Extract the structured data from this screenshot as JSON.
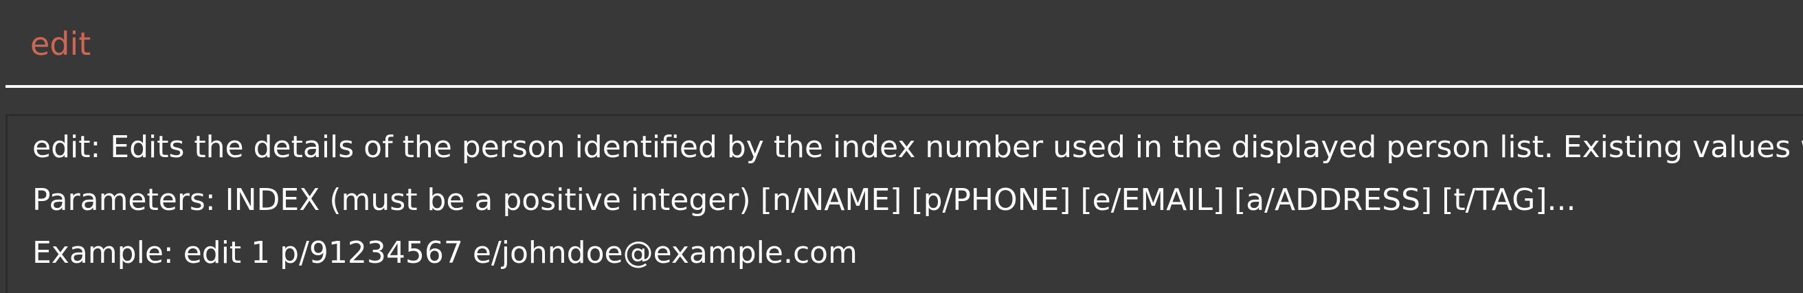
{
  "command_box": {
    "value": "edit"
  },
  "result_display": {
    "lines": [
      "edit: Edits the details of the person identified by the index number used in the displayed person list. Existing values will b",
      "Parameters: INDEX (must be a positive integer) [n/NAME] [p/PHONE] [e/EMAIL] [a/ADDRESS] [t/TAG]...",
      "Example: edit 1 p/91234567 e/johndoe@example.com"
    ]
  },
  "colors": {
    "background": "#383838",
    "command_text": "#d06651",
    "result_text": "#ffffff",
    "underline": "#ffffff"
  }
}
